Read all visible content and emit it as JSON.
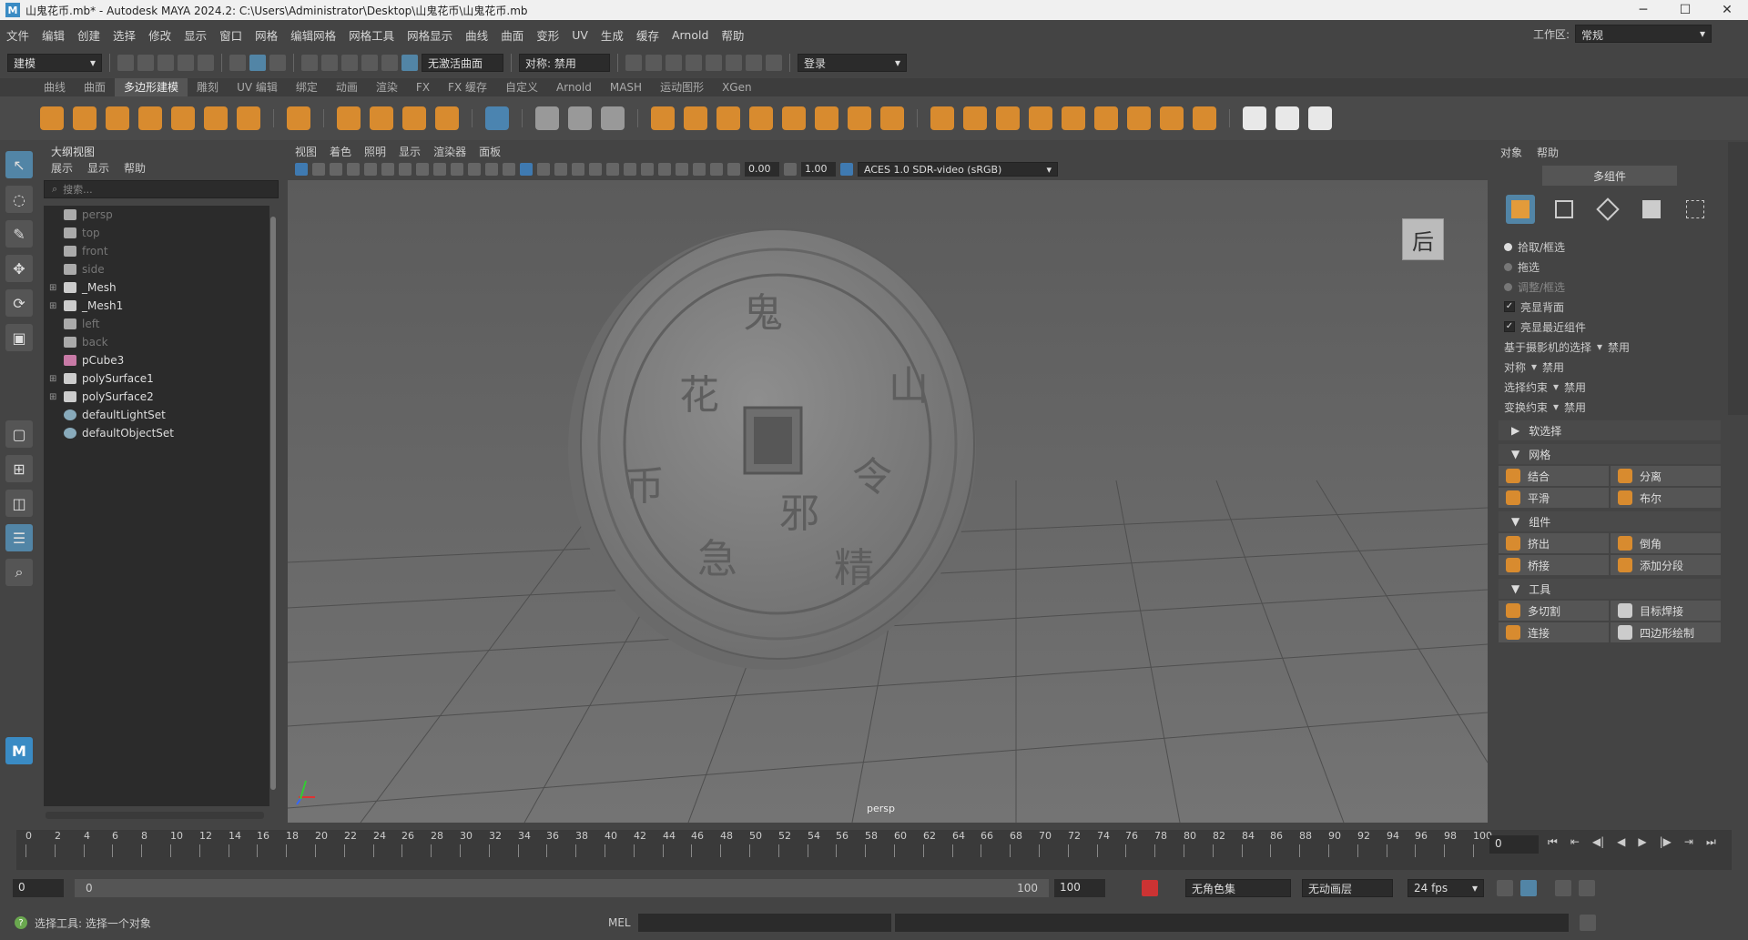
{
  "window": {
    "title": "山鬼花币.mb* - Autodesk MAYA 2024.2: C:\\Users\\Administrator\\Desktop\\山鬼花币\\山鬼花币.mb",
    "minimize": "─",
    "maximize": "☐",
    "close": "✕"
  },
  "menubar": {
    "items": [
      "文件",
      "编辑",
      "创建",
      "选择",
      "修改",
      "显示",
      "窗口",
      "网格",
      "编辑网格",
      "网格工具",
      "网格显示",
      "曲线",
      "曲面",
      "变形",
      "UV",
      "生成",
      "缓存",
      "Arnold",
      "帮助"
    ],
    "workspace_label": "工作区:",
    "workspace_value": "常规"
  },
  "toolbar": {
    "mode": "建模",
    "live_surface": "无激活曲面",
    "symmetry": "对称: 禁用",
    "login": "登录"
  },
  "shelf_tabs": [
    "曲线",
    "曲面",
    "多边形建模",
    "雕刻",
    "UV 编辑",
    "绑定",
    "动画",
    "渲染",
    "FX",
    "FX 缓存",
    "自定义",
    "Arnold",
    "MASH",
    "运动图形",
    "XGen"
  ],
  "shelf_active": "多边形建模",
  "outliner": {
    "title": "大纲视图",
    "menu": [
      "展示",
      "显示",
      "帮助"
    ],
    "search_placeholder": "搜索...",
    "items": [
      {
        "label": "persp",
        "type": "camera",
        "dim": true,
        "expand": ""
      },
      {
        "label": "top",
        "type": "camera",
        "dim": true,
        "expand": ""
      },
      {
        "label": "front",
        "type": "camera",
        "dim": true,
        "expand": ""
      },
      {
        "label": "side",
        "type": "camera",
        "dim": true,
        "expand": ""
      },
      {
        "label": "_Mesh",
        "type": "group",
        "dim": false,
        "expand": "⊞"
      },
      {
        "label": "_Mesh1",
        "type": "group",
        "dim": false,
        "expand": "⊞"
      },
      {
        "label": "left",
        "type": "camera",
        "dim": true,
        "expand": ""
      },
      {
        "label": "back",
        "type": "camera",
        "dim": true,
        "expand": ""
      },
      {
        "label": "pCube3",
        "type": "mesh",
        "dim": false,
        "expand": ""
      },
      {
        "label": "polySurface1",
        "type": "group",
        "dim": false,
        "expand": "⊞"
      },
      {
        "label": "polySurface2",
        "type": "group",
        "dim": false,
        "expand": "⊞"
      },
      {
        "label": "defaultLightSet",
        "type": "set",
        "dim": false,
        "expand": ""
      },
      {
        "label": "defaultObjectSet",
        "type": "set",
        "dim": false,
        "expand": ""
      }
    ]
  },
  "viewport": {
    "menu": [
      "视图",
      "着色",
      "照明",
      "显示",
      "渲染器",
      "面板"
    ],
    "exposure": "0.00",
    "gamma": "1.00",
    "color_space": "ACES 1.0 SDR-video (sRGB)",
    "camera": "persp",
    "viewcube_label": "后",
    "coin_glyphs": [
      "山",
      "鬼",
      "花",
      "币",
      "邪",
      "精",
      "急",
      "令"
    ]
  },
  "modeling_toolkit": {
    "menu": [
      "对象",
      "帮助"
    ],
    "header": "多组件",
    "pick_modes": [
      "拾取/框选",
      "拖选",
      "调整/框选"
    ],
    "checks": [
      "亮显背面",
      "亮显最近组件"
    ],
    "camera_based": "基于摄影机的选择",
    "camera_based_value": "禁用",
    "symmetry": "对称",
    "symmetry_value": "禁用",
    "select_constraint": "选择约束",
    "select_constraint_value": "禁用",
    "transform_constraint": "变换约束",
    "transform_constraint_value": "禁用",
    "soft_select": "软选择",
    "sections": [
      {
        "title": "网格",
        "buttons": [
          "结合",
          "分离",
          "平滑",
          "布尔"
        ]
      },
      {
        "title": "组件",
        "buttons": [
          "挤出",
          "倒角",
          "桥接",
          "添加分段"
        ]
      },
      {
        "title": "工具",
        "buttons": [
          "多切割",
          "目标焊接",
          "连接",
          "四边形绘制"
        ]
      }
    ]
  },
  "timeline": {
    "ticks": [
      "0",
      "2",
      "4",
      "6",
      "8",
      "10",
      "12",
      "14",
      "16",
      "18",
      "20",
      "22",
      "24",
      "26",
      "28",
      "30",
      "32",
      "34",
      "36",
      "38",
      "40",
      "42",
      "44",
      "46",
      "48",
      "50",
      "52",
      "54",
      "56",
      "58",
      "60",
      "62",
      "64",
      "66",
      "68",
      "70",
      "72",
      "74",
      "76",
      "78",
      "80",
      "82",
      "84",
      "86",
      "88",
      "90",
      "92",
      "94",
      "96",
      "98",
      "100"
    ],
    "current_frame": "0",
    "range_start": "0",
    "range_inner_start": "0",
    "range_inner_end": "100",
    "range_end": "100",
    "character_set": "无角色集",
    "anim_layer": "无动画层",
    "fps": "24 fps"
  },
  "status": {
    "help_text": "选择工具: 选择一个对象",
    "mel_label": "MEL"
  }
}
